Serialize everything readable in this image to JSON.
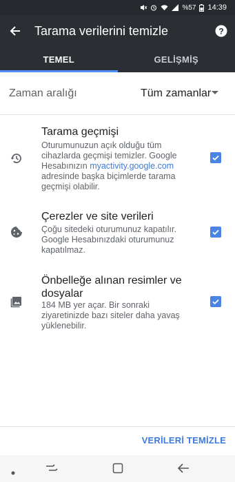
{
  "status_bar": {
    "battery": "%57",
    "time": "14:39"
  },
  "app_bar": {
    "title": "Tarama verilerini temizle",
    "back_icon": "arrow-back-icon",
    "help_icon": "help-icon"
  },
  "tabs": [
    {
      "label": "TEMEL",
      "active": true
    },
    {
      "label": "GELİŞMİŞ",
      "active": false
    }
  ],
  "time_range": {
    "label": "Zaman aralığı",
    "value": "Tüm zamanlar"
  },
  "items": [
    {
      "icon": "history-icon",
      "title": "Tarama geçmişi",
      "desc_before": "Oturumunuzun açık olduğu tüm cihazlarda geçmişi temizler. Google Hesabınızın ",
      "desc_link": "myactivity.google.com",
      "desc_after": " adresinde başka biçimlerde tarama geçmişi olabilir.",
      "checked": true
    },
    {
      "icon": "cookie-icon",
      "title": "Çerezler ve site verileri",
      "desc": "Çoğu sitedeki oturumunuz kapatılır. Google Hesabınızdaki oturumunuz kapatılmaz.",
      "checked": true
    },
    {
      "icon": "image-icon",
      "title": "Önbelleğe alınan resimler ve dosyalar",
      "desc": "184 MB yer açar. Bir sonraki ziyaretinizde bazı siteler daha yavaş yüklenebilir.",
      "checked": true
    }
  ],
  "clear_button": "VERİLERİ TEMİZLE",
  "colors": {
    "app_bar": "#2b2e32",
    "accent": "#4a85e6",
    "link": "#3f7bd9"
  }
}
